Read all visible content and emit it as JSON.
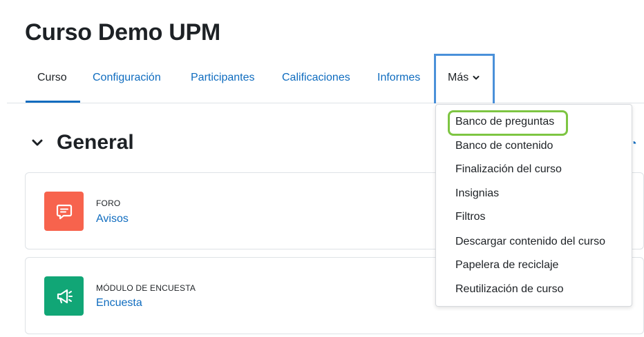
{
  "course": {
    "title": "Curso Demo UPM"
  },
  "tabs": {
    "curso": "Curso",
    "configuracion": "Configuración",
    "participantes": "Participantes",
    "calificaciones": "Calificaciones",
    "informes": "Informes",
    "mas": "Más"
  },
  "section": {
    "title": "General"
  },
  "activities": [
    {
      "type": "FORO",
      "name": "Avisos",
      "icon": "forum-icon",
      "color": "#f7634d"
    },
    {
      "type": "MÓDULO DE ENCUESTA",
      "name": "Encuesta",
      "icon": "megaphone-icon",
      "color": "#11a676"
    }
  ],
  "menu": {
    "items": [
      "Banco de preguntas",
      "Banco de contenido",
      "Finalización del curso",
      "Insignias",
      "Filtros",
      "Descargar contenido del curso",
      "Papelera de reciclaje",
      "Reutilización de curso"
    ],
    "highlight_color": "#7dc542"
  },
  "colors": {
    "link": "#0f6cbf",
    "tab_focus_border": "#4a90d9"
  }
}
